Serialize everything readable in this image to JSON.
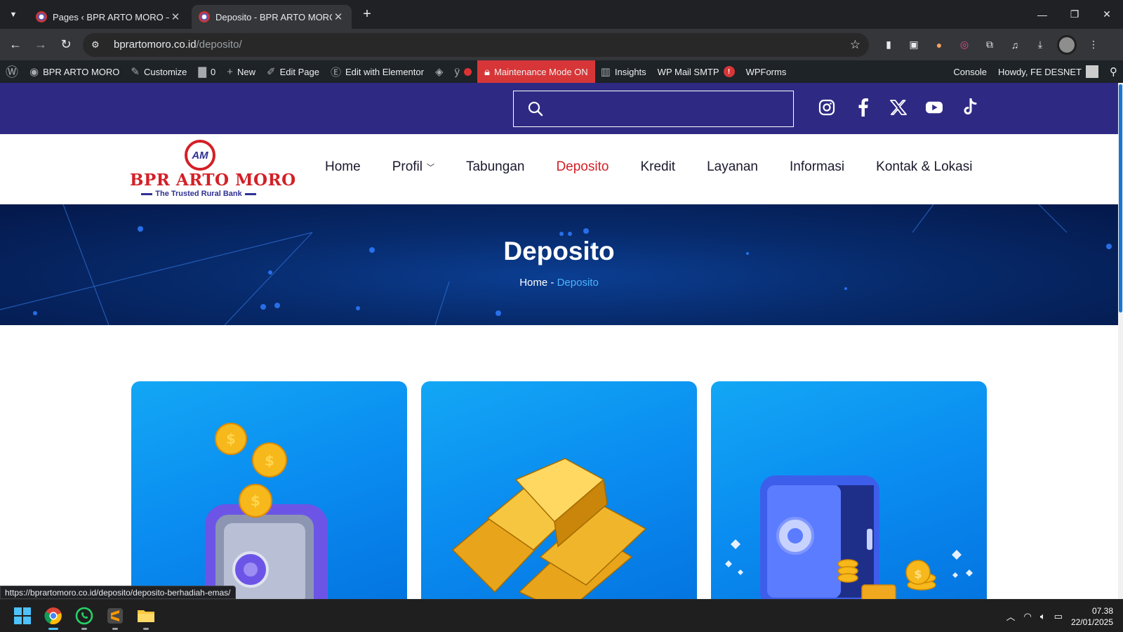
{
  "browser": {
    "tabs": [
      {
        "title": "Pages ‹ BPR ARTO MORO — WordPress",
        "active": false
      },
      {
        "title": "Deposito - BPR ARTO MORO",
        "active": true
      }
    ],
    "new_tab_symbol": "+",
    "url_host": "bprartomoro.co.id",
    "url_path": "/deposito/",
    "status_link": "https://bprartomoro.co.id/deposito/deposito-berhadiah-emas/"
  },
  "adminbar": {
    "site_name": "BPR ARTO MORO",
    "customize": "Customize",
    "comments_count": "0",
    "new": "New",
    "edit_page": "Edit Page",
    "edit_elementor": "Edit with Elementor",
    "maintenance": "Maintenance Mode ON",
    "insights": "Insights",
    "wp_mail_smtp": "WP Mail SMTP",
    "smtp_badge": "!",
    "wpforms": "WPForms",
    "console": "Console",
    "howdy": "Howdy, FE DESNET"
  },
  "site": {
    "search_placeholder": "",
    "socials": [
      "instagram-icon",
      "facebook-icon",
      "x-twitter-icon",
      "youtube-icon",
      "tiktok-icon"
    ],
    "logo": {
      "mark": "AM",
      "brand": "BPR ARTO MORO",
      "tagline": "The Trusted Rural Bank"
    },
    "nav": [
      {
        "label": "Home",
        "current": false,
        "dropdown": false
      },
      {
        "label": "Profil",
        "current": false,
        "dropdown": true
      },
      {
        "label": "Tabungan",
        "current": false,
        "dropdown": false
      },
      {
        "label": "Deposito",
        "current": true,
        "dropdown": false
      },
      {
        "label": "Kredit",
        "current": false,
        "dropdown": false
      },
      {
        "label": "Layanan",
        "current": false,
        "dropdown": false
      },
      {
        "label": "Informasi",
        "current": false,
        "dropdown": false
      },
      {
        "label": "Kontak & Lokasi",
        "current": false,
        "dropdown": false
      }
    ],
    "hero": {
      "title": "Deposito",
      "crumb_home": "Home",
      "crumb_sep": "-",
      "crumb_current": "Deposito"
    },
    "cards": [
      "coin-safe-illustration",
      "gold-bars-illustration",
      "vault-safe-illustration"
    ]
  },
  "taskbar": {
    "time": "07.38",
    "date": "22/01/2025"
  },
  "colors": {
    "accent_red": "#d32027",
    "topbar_purple": "#2e2a84",
    "breadcrumb_blue": "#4cb3ff"
  }
}
